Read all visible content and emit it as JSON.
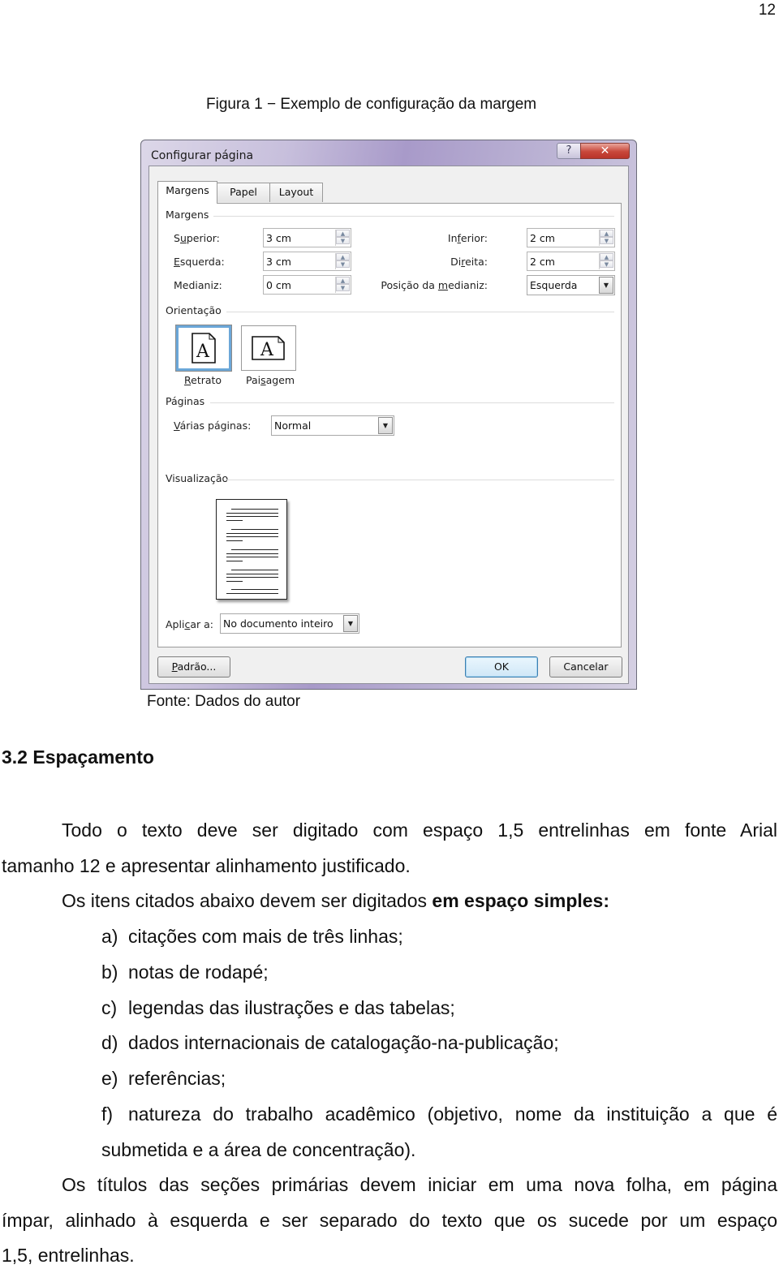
{
  "page_number": "12",
  "figure": {
    "caption": "Figura 1 − Exemplo de configuração da margem",
    "source": "Fonte: Dados do autor"
  },
  "dialog": {
    "title": "Configurar página",
    "help_glyph": "?",
    "close_glyph": "✕",
    "tabs": [
      {
        "label": "Margens",
        "active": true
      },
      {
        "label": "Papel",
        "active": false
      },
      {
        "label": "Layout",
        "active": false
      }
    ],
    "margins": {
      "group_label": "Margens",
      "top": {
        "label_pre": "S",
        "label_u": "u",
        "label_post": "perior:",
        "value": "3 cm"
      },
      "left": {
        "label_pre": "",
        "label_u": "E",
        "label_post": "squerda:",
        "value": "3 cm"
      },
      "gutter": {
        "label_pre": "Medianiz",
        "label_u": "",
        "label_post": ":",
        "value": "0 cm"
      },
      "bottom": {
        "label_pre": "In",
        "label_u": "f",
        "label_post": "erior:",
        "value": "2 cm"
      },
      "right": {
        "label_pre": "Di",
        "label_u": "r",
        "label_post": "eita:",
        "value": "2 cm"
      },
      "gutter_position": {
        "label_pre": "Posição da ",
        "label_u": "m",
        "label_post": "edianiz:",
        "value": "Esquerda"
      }
    },
    "orientation": {
      "group_label": "Orientação",
      "portrait": {
        "label_u": "R",
        "label_post": "etrato",
        "selected": true
      },
      "landscape": {
        "label_pre": "Pai",
        "label_u": "s",
        "label_post": "agem",
        "selected": false
      },
      "icon_glyph": "A"
    },
    "pages": {
      "group_label": "Páginas",
      "multiple_label_u": "V",
      "multiple_label_post": "árias páginas:",
      "multiple_value": "Normal"
    },
    "preview": {
      "group_label": "Visualização"
    },
    "apply_to": {
      "label_pre": "Apli",
      "label_u": "c",
      "label_post": "ar a:",
      "value": "No documento inteiro"
    },
    "buttons": {
      "default_u": "P",
      "default_post": "adrão...",
      "ok": "OK",
      "cancel": "Cancelar"
    }
  },
  "section": {
    "heading": "3.2 Espaçamento",
    "para1": {
      "line1": "Todo o texto deve ser digitado com espaço 1,5 entrelinhas em fonte Arial",
      "line2": "tamanho 12 e apresentar alinhamento justificado."
    },
    "para2": {
      "text": "Os itens citados abaixo devem ser digitados ",
      "bold": "em espaço simples:"
    },
    "list": [
      {
        "marker": "a)",
        "text": "citações com mais de três linhas;"
      },
      {
        "marker": "b)",
        "text": "notas de rodapé;"
      },
      {
        "marker": "c)",
        "text": "legendas das ilustrações e das tabelas;"
      },
      {
        "marker": "d)",
        "text": "dados internacionais de catalogação-na-publicação;"
      },
      {
        "marker": "e)",
        "text": "referências;"
      },
      {
        "marker": "f)",
        "text": "natureza do trabalho acadêmico (objetivo, nome da instituição a que é",
        "continuation": "submetida e a área de concentração)."
      }
    ],
    "para3": {
      "line1": "Os títulos das seções primárias devem iniciar em uma nova folha, em página",
      "line2": "ímpar, alinhado à esquerda e ser separado do texto que os sucede por um espaço",
      "line3": "1,5, entrelinhas."
    }
  }
}
